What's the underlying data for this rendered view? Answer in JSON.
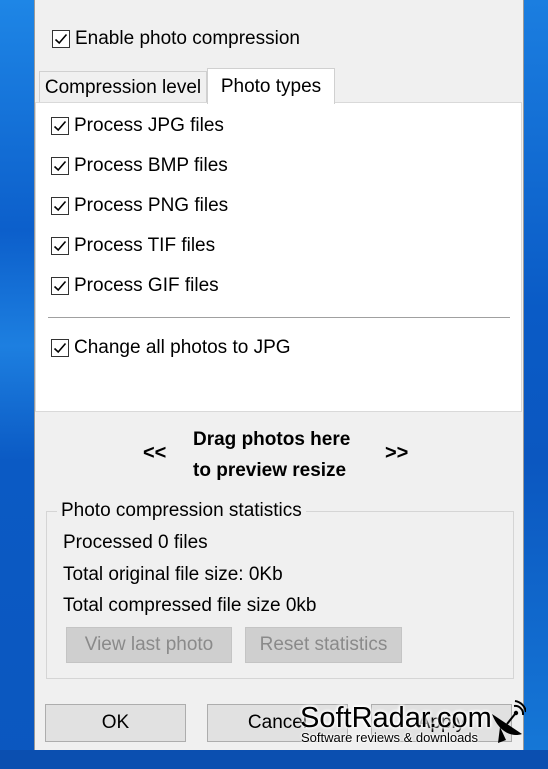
{
  "enable_compression": {
    "label": "Enable photo compression",
    "checked": true
  },
  "tabs": [
    {
      "label": "Compression level",
      "active": false
    },
    {
      "label": "Photo types",
      "active": true
    }
  ],
  "photo_types": [
    {
      "label": "Process JPG files",
      "checked": true
    },
    {
      "label": "Process BMP files",
      "checked": true
    },
    {
      "label": "Process PNG files",
      "checked": true
    },
    {
      "label": "Process TIF files",
      "checked": true
    },
    {
      "label": "Process GIF files",
      "checked": true
    }
  ],
  "change_to_jpg": {
    "label": "Change all photos to JPG",
    "checked": true
  },
  "drag_area": {
    "left_arrow": "<<",
    "line1": "Drag photos here",
    "line2": "to preview resize",
    "right_arrow": ">>"
  },
  "stats": {
    "title": "Photo compression statistics",
    "processed": "Processed 0 files",
    "original_size": "Total original file size: 0Kb",
    "compressed_size": "Total compressed file size 0kb",
    "view_last_label": "View last photo",
    "reset_label": "Reset statistics"
  },
  "buttons": {
    "ok": "OK",
    "cancel": "Cancel",
    "apply": "Apply"
  },
  "watermark": {
    "name": "SoftRadar.com",
    "tagline": "Software reviews & downloads"
  }
}
